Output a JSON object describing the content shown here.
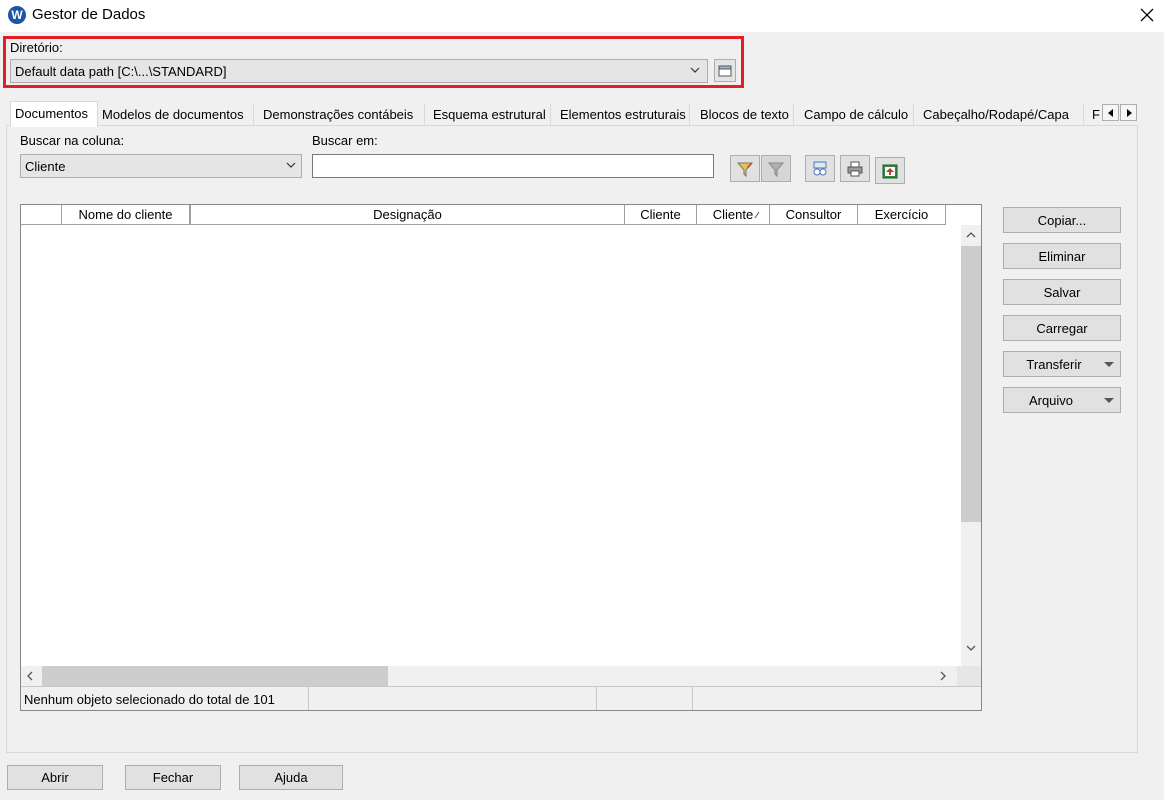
{
  "window": {
    "title": "Gestor de Dados",
    "logo_letter": "W"
  },
  "directory": {
    "label": "Diretório:",
    "value": "Default data path [C:\\...\\STANDARD]"
  },
  "tabs": [
    {
      "label": "Documentos",
      "active": true
    },
    {
      "label": "Modelos de documentos"
    },
    {
      "label": "Demonstrações contábeis"
    },
    {
      "label": "Esquema estrutural"
    },
    {
      "label": "Elementos estruturais"
    },
    {
      "label": "Blocos de texto"
    },
    {
      "label": "Campo de cálculo"
    },
    {
      "label": "Cabeçalho/Rodapé/Capa"
    },
    {
      "label": "F"
    }
  ],
  "search": {
    "column_label": "Buscar na coluna:",
    "column_value": "Cliente",
    "in_label": "Buscar em:",
    "in_value": ""
  },
  "grid": {
    "columns": [
      "",
      "Nome do cliente",
      "Designação",
      "Cliente",
      "Cliente",
      "Consultor",
      "Exercício"
    ],
    "status": "Nenhum objeto selecionado do total de 101"
  },
  "side_buttons": {
    "copy": "Copiar...",
    "delete": "Eliminar",
    "save": "Salvar",
    "load": "Carregar",
    "transfer": "Transferir",
    "archive": "Arquivo"
  },
  "bottom_buttons": {
    "open": "Abrir",
    "close": "Fechar",
    "help": "Ajuda"
  },
  "colors": {
    "highlight_border": "#e31e24",
    "logo_blue": "#1c54a8"
  },
  "icons": [
    "app-logo-icon",
    "close-icon",
    "chevron-down-icon",
    "browse-folder-icon",
    "filter-apply-icon",
    "filter-clear-icon",
    "sort-icon",
    "print-icon",
    "export-icon",
    "chevron-up-icon",
    "chevron-left-icon",
    "chevron-right-icon",
    "dropdown-arrow-icon"
  ]
}
